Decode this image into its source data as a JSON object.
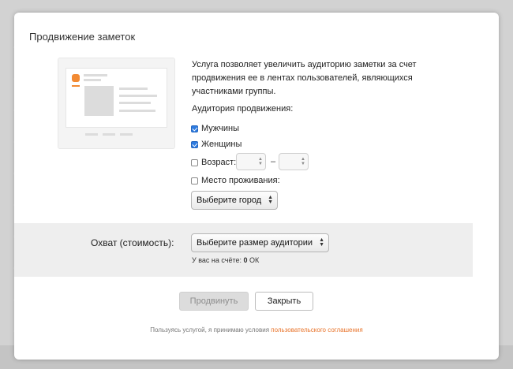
{
  "dialog": {
    "title": "Продвижение заметок",
    "description": "Услуга позволяет увеличить аудиторию заметки за счет продвижения ее в лентах пользователей, являющихся участниками группы.",
    "audience_label": "Аудитория продвижения:",
    "options": {
      "men": {
        "label": "Мужчины",
        "checked": true
      },
      "women": {
        "label": "Женщины",
        "checked": true
      },
      "age": {
        "label": "Возраст:",
        "checked": false
      },
      "residence": {
        "label": "Место проживания:",
        "checked": false
      }
    },
    "age_from": "",
    "age_to": "",
    "age_separator": "–",
    "city_select": {
      "value": "Выберите город"
    },
    "reach": {
      "label": "Охват (стоимость):",
      "select_value": "Выберите размер аудитории",
      "balance_prefix": "У вас на счёте: ",
      "balance_value": "0",
      "balance_unit": " ОК"
    },
    "buttons": {
      "promote": "Продвинуть",
      "close": "Закрыть"
    },
    "terms": {
      "text": "Пользуясь услугой, я принимаю условия ",
      "link": "пользовательского соглашения"
    }
  },
  "colors": {
    "accent": "#e8732a",
    "checkbox": "#2d7be0"
  }
}
